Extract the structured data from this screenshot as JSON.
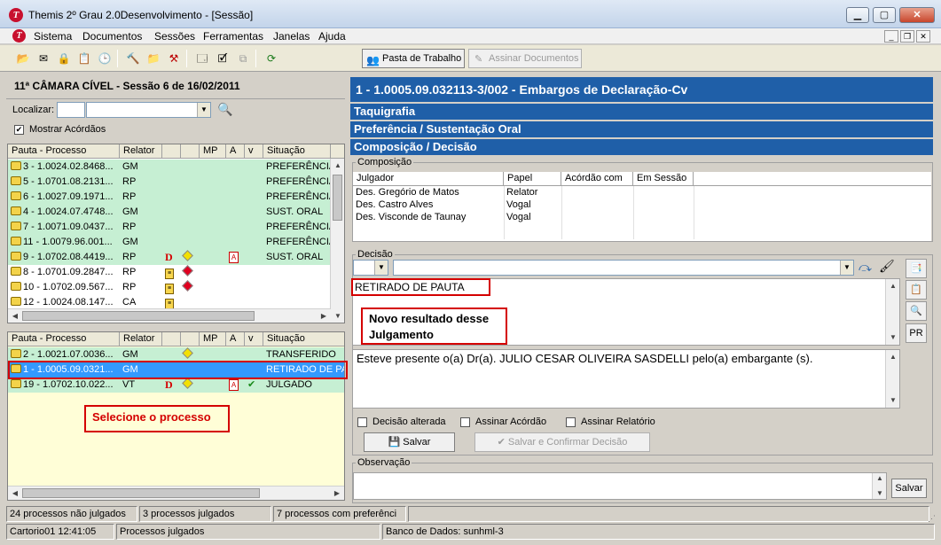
{
  "window": {
    "title": "Themis 2º Grau 2.0Desenvolvimento - [Sessão]",
    "app_icon_letter": "T"
  },
  "menu": {
    "items": [
      "Sistema",
      "Documentos",
      "Sessões",
      "Ferramentas",
      "Janelas",
      "Ajuda"
    ]
  },
  "toolbar": {
    "pasta_label": "Pasta de Trabalho",
    "assinar_label": "Assinar Documentos"
  },
  "left": {
    "session_title": "11ª CÂMARA CÍVEL - Sessão 6 de 16/02/2011",
    "localizar_label": "Localizar:",
    "mostrar_label": "Mostrar Acórdãos",
    "top_grid": {
      "headers": [
        "Pauta - Processo",
        "Relator",
        "",
        "",
        "MP",
        "A",
        "v",
        "Situação"
      ],
      "rows": [
        {
          "proc": "3 - 1.0024.02.8468...",
          "relator": "GM",
          "d": "",
          "flag": "",
          "a": "",
          "situacao": "PREFERÊNCIA",
          "style": "green"
        },
        {
          "proc": "5 - 1.0701.08.2131...",
          "relator": "RP",
          "d": "",
          "flag": "",
          "a": "",
          "situacao": "PREFERÊNCIA",
          "style": "green"
        },
        {
          "proc": "6 - 1.0027.09.1971...",
          "relator": "RP",
          "d": "",
          "flag": "",
          "a": "",
          "situacao": "PREFERÊNCIA",
          "style": "green"
        },
        {
          "proc": "4 - 1.0024.07.4748...",
          "relator": "GM",
          "d": "",
          "flag": "",
          "a": "",
          "situacao": "SUST. ORAL",
          "style": "green"
        },
        {
          "proc": "7 - 1.0071.09.0437...",
          "relator": "RP",
          "d": "",
          "flag": "",
          "a": "",
          "situacao": "PREFERÊNCIA",
          "style": "green"
        },
        {
          "proc": "11 - 1.0079.96.001...",
          "relator": "GM",
          "d": "",
          "flag": "",
          "a": "",
          "situacao": "PREFERÊNCIA",
          "style": "green"
        },
        {
          "proc": "9 - 1.0702.08.4419...",
          "relator": "RP",
          "d": "D",
          "flag": "yellow",
          "a": "A",
          "situacao": "SUST. ORAL",
          "style": "green"
        },
        {
          "proc": "8 - 1.0701.09.2847...",
          "relator": "RP",
          "d": "",
          "flag": "red",
          "a": "",
          "situacao": "",
          "style": "white"
        },
        {
          "proc": "10 - 1.0702.09.567...",
          "relator": "RP",
          "d": "",
          "flag": "red",
          "a": "",
          "situacao": "",
          "style": "white"
        },
        {
          "proc": "12 - 1.0024.08.147...",
          "relator": "CA",
          "d": "",
          "flag": "",
          "a": "",
          "situacao": "",
          "style": "white"
        }
      ]
    },
    "bottom_grid": {
      "headers": [
        "Pauta - Processo",
        "Relator",
        "",
        "",
        "MP",
        "A",
        "v",
        "Situação"
      ],
      "rows": [
        {
          "proc": "2 - 1.0021.07.0036...",
          "relator": "GM",
          "d": "",
          "flag": "yellow",
          "a": "",
          "check": "",
          "situacao": "TRANSFERIDO",
          "style": "green"
        },
        {
          "proc": "1 - 1.0005.09.0321...",
          "relator": "GM",
          "d": "",
          "flag": "",
          "a": "",
          "check": "",
          "situacao": "RETIRADO DE PA",
          "style": "selected"
        },
        {
          "proc": "19 - 1.0702.10.022...",
          "relator": "VT",
          "d": "D",
          "flag": "yellow",
          "a": "A",
          "check": "✔",
          "situacao": "JULGADO",
          "style": "green"
        }
      ]
    },
    "annotation": "Selecione o processo"
  },
  "right": {
    "process_title": "1   -   1.0005.09.032113-3/002 - Embargos de Declaração-Cv",
    "sections": [
      "Taquigrafia",
      "Preferência / Sustentação Oral",
      "Composição / Decisão"
    ],
    "composicao": {
      "label": "Composição",
      "headers": [
        "Julgador",
        "Papel",
        "Acórdão com",
        "Em Sessão"
      ],
      "rows": [
        {
          "julgador": "Des. Gregório de Matos",
          "papel": "Relator"
        },
        {
          "julgador": "Des. Castro Alves",
          "papel": "Vogal"
        },
        {
          "julgador": "Des. Visconde de Taunay",
          "papel": "Vogal"
        }
      ]
    },
    "decisao": {
      "label": "Decisão",
      "result_text": "RETIRADO DE PAUTA",
      "annotation": "Novo resultado desse Julgamento",
      "decision_text": "Esteve presente  o(a) Dr(a). JULIO CESAR OLIVEIRA SASDELLI pelo(a) embargante (s).",
      "chk_alterada": "Decisão alterada",
      "chk_acordao": "Assinar Acórdão",
      "chk_relatorio": "Assinar Relatório",
      "salvar_label": "Salvar",
      "confirmar_label": "Salvar e Confirmar Decisão",
      "pr_label": "PR"
    },
    "observacao": {
      "label": "Observação",
      "salvar_label": "Salvar"
    }
  },
  "status": {
    "nao_julgados": "24 processos não julgados",
    "julgados": "3 processos julgados",
    "preferencia": "7 processos com preferênci",
    "user_time": "Cartorio01  12:41:05",
    "current_view": "Processos julgados",
    "database": "Banco de Dados: sunhml-3"
  },
  "colors": {
    "header_blue": "#1f5fa8",
    "row_green": "#c6efd3",
    "row_selected": "#3399ff",
    "annotation_red": "#d40000"
  }
}
